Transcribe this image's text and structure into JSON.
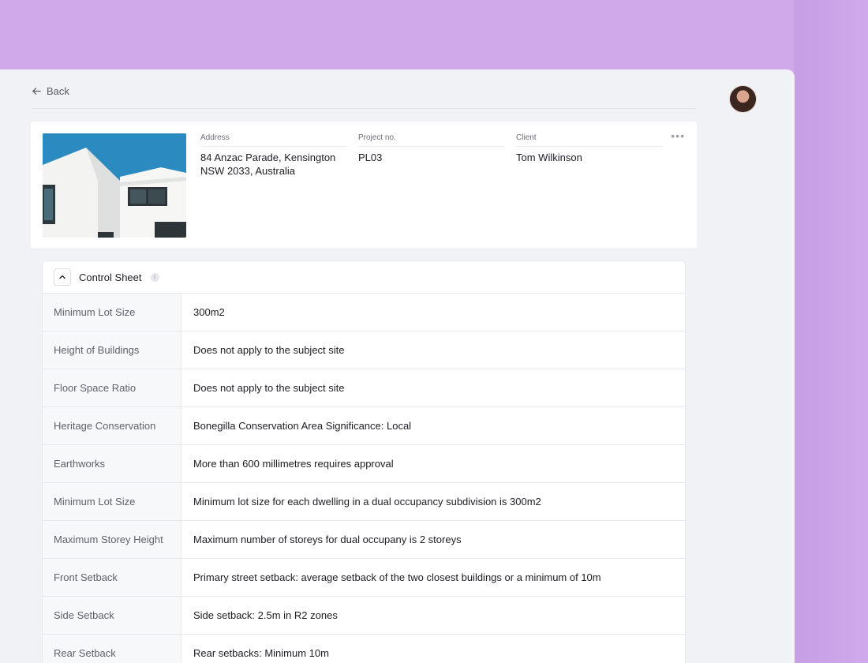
{
  "nav": {
    "back_label": "Back"
  },
  "project": {
    "address_label": "Address",
    "address_line1": "84 Anzac Parade, Kensington",
    "address_line2": "NSW 2033, Australia",
    "project_no_label": "Project no.",
    "project_no": "PL03",
    "client_label": "Client",
    "client": "Tom Wilkinson",
    "more_label": "•••"
  },
  "control_sheet": {
    "title": "Control Sheet",
    "info_glyph": "i",
    "rows": [
      {
        "label": "Minimum Lot Size",
        "value": "300m2"
      },
      {
        "label": "Height of Buildings",
        "value": "Does not apply to the subject site"
      },
      {
        "label": "Floor Space Ratio",
        "value": "Does not apply to the subject site"
      },
      {
        "label": "Heritage Conservation",
        "value": "Bonegilla Conservation Area Significance: Local"
      },
      {
        "label": "Earthworks",
        "value": "More than 600 millimetres requires approval"
      },
      {
        "label": "Minimum Lot Size",
        "value": "Minimum lot size for each dwelling in a dual occupancy subdivision is 300m2"
      },
      {
        "label": "Maximum Storey Height",
        "value": "Maximum number of storeys for dual occupany is 2 storeys"
      },
      {
        "label": "Front Setback",
        "value": "Primary street setback: average setback of the two closest buildings or a minimum of 10m"
      },
      {
        "label": "Side Setback",
        "value": "Side setback: 2.5m in R2 zones"
      },
      {
        "label": "Rear Setback",
        "value": "Rear setbacks: Minimum 10m"
      }
    ]
  },
  "colors": {
    "background": "#cfa9ea",
    "window": "#f1f2f5",
    "card": "#ffffff"
  },
  "icons": {
    "back": "arrow-left-icon",
    "collapse": "chevron-up-icon",
    "info": "info-icon",
    "more": "more-horizontal-icon"
  }
}
